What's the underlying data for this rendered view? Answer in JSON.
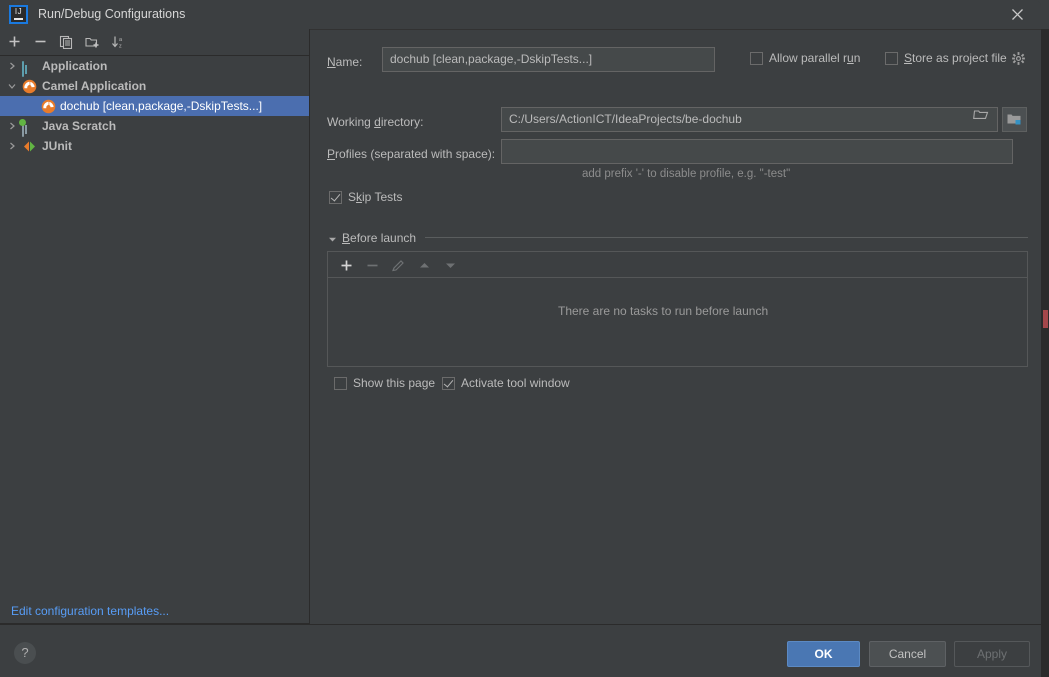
{
  "window": {
    "title": "Run/Debug Configurations",
    "logo_icon": "intellij-idea-logo",
    "close_icon": "close-icon"
  },
  "sidebar": {
    "toolbar": [
      {
        "name": "add-configuration-button",
        "icon": "plus-icon",
        "label": "+"
      },
      {
        "name": "remove-configuration-button",
        "icon": "minus-icon",
        "label": "−"
      },
      {
        "name": "copy-configuration-button",
        "icon": "copy-icon",
        "label": "Copy"
      },
      {
        "name": "new-folder-button",
        "icon": "folder-plus-icon",
        "label": "New Folder"
      },
      {
        "name": "sort-configurations-button",
        "icon": "sort-alphabetical-icon",
        "label": "Sort"
      }
    ],
    "tree": [
      {
        "label": "Application",
        "icon": "application-window-icon",
        "depth": 0,
        "expanded": false,
        "selected": false,
        "bold": true,
        "arrow": "chevron-right"
      },
      {
        "label": "Camel Application",
        "icon": "camel-logo-icon",
        "depth": 0,
        "expanded": true,
        "selected": false,
        "bold": true,
        "arrow": "chevron-down"
      },
      {
        "label": "dochub [clean,package,-DskipTests...]",
        "icon": "camel-logo-icon",
        "depth": 1,
        "expanded": false,
        "selected": true,
        "bold": false,
        "arrow": "none"
      },
      {
        "label": "Java Scratch",
        "icon": "java-scratch-icon",
        "depth": 0,
        "expanded": false,
        "selected": false,
        "bold": true,
        "arrow": "chevron-right"
      },
      {
        "label": "JUnit",
        "icon": "junit-icon",
        "depth": 0,
        "expanded": false,
        "selected": false,
        "bold": true,
        "arrow": "chevron-right"
      }
    ],
    "edit_templates_link": "Edit configuration templates..."
  },
  "form": {
    "name_label_prefix": "N",
    "name_label_rest": "ame:",
    "name_value": "dochub [clean,package,-DskipTests...]",
    "allow_parallel_run": {
      "label_pre": "Allow parallel r",
      "label_mn": "u",
      "label_post": "n",
      "checked": false
    },
    "store_as_project_file": {
      "label_mn": "S",
      "label_post": "tore as project file",
      "checked": false,
      "gear_icon": "gear-icon"
    },
    "working_directory_label_pre": "Working ",
    "working_directory_label_mn": "d",
    "working_directory_label_post": "irectory:",
    "working_directory_value": "C:/Users/ActionICT/IdeaProjects/be-dochub",
    "browse_icon": "folder-open-icon",
    "macro_icon": "folder-macro-icon",
    "profiles_label_mn": "P",
    "profiles_label_post": "rofiles (separated with space):",
    "profiles_value": "",
    "profiles_hint": "add prefix '-' to disable profile, e.g. \"-test\"",
    "skip_tests": {
      "label_pre": "S",
      "label_mn": "k",
      "label_post": "ip Tests",
      "checked": true
    }
  },
  "before_launch": {
    "title_mn": "B",
    "title_post": "efore launch",
    "expanded": true,
    "toolbar": [
      {
        "name": "add-task-button",
        "icon": "plus-icon",
        "enabled": true
      },
      {
        "name": "remove-task-button",
        "icon": "minus-icon",
        "enabled": false
      },
      {
        "name": "edit-task-button",
        "icon": "pencil-icon",
        "enabled": false
      },
      {
        "name": "move-task-up-button",
        "icon": "arrow-up-icon",
        "enabled": false
      },
      {
        "name": "move-task-down-button",
        "icon": "arrow-down-icon",
        "enabled": false
      }
    ],
    "empty_text": "There are no tasks to run before launch",
    "show_this_page": {
      "label": "Show this page",
      "checked": false
    },
    "activate_tool_window": {
      "label": "Activate tool window",
      "checked": true
    }
  },
  "footer": {
    "help_label": "?",
    "ok_label": "OK",
    "cancel_label": "Cancel",
    "apply_label": "Apply",
    "apply_enabled": false
  },
  "colors": {
    "dialog_bg": "#3c3f41",
    "field_bg": "#45494a",
    "selection_blue": "#4b6eaf",
    "link_blue": "#589df6",
    "ok_button_blue": "#4a77b3",
    "camel_orange": "#e87b2a",
    "scratch_badge_green": "#62b543"
  }
}
